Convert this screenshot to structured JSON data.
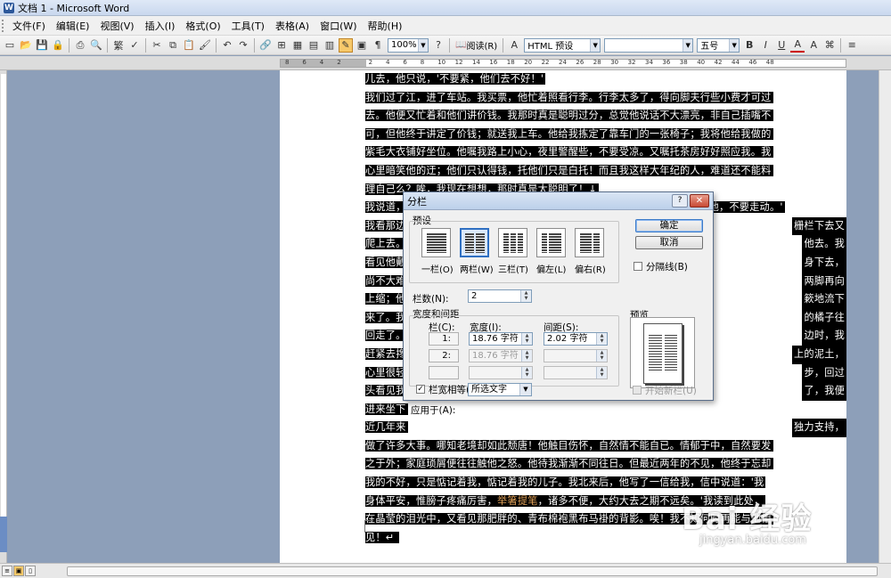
{
  "window": {
    "title": "文档 1 - Microsoft Word"
  },
  "menu": [
    "文件(F)",
    "编辑(E)",
    "视图(V)",
    "插入(I)",
    "格式(O)",
    "工具(T)",
    "表格(A)",
    "窗口(W)",
    "帮助(H)"
  ],
  "toolbar": {
    "zoom": "100%",
    "read_label": "阅读(R)",
    "style": "HTML 预设",
    "font_name": "",
    "font_size": "五号",
    "bold_label": "B",
    "italic_label": "I",
    "underline_label": "U",
    "font_color_label": "A"
  },
  "ruler": [
    "8",
    "6",
    "4",
    "2",
    "2",
    "4",
    "6",
    "8",
    "10",
    "12",
    "14",
    "16",
    "18",
    "20",
    "22",
    "24",
    "26",
    "28",
    "30",
    "32",
    "34",
    "36",
    "38",
    "40",
    "42",
    "44",
    "46",
    "48"
  ],
  "document": {
    "lines": [
      "儿去，他只说，'不要紧，他们去不好！'",
      "我们过了江，进了车站。我买票，他忙着照看行李。行李太多了，得向脚夫行些小费才可过",
      "去。他便又忙着和他们讲价钱。我那时真是聪明过分，总觉他说话不大漂亮，非自己插嘴不",
      "可，但他终于讲定了价钱；就送我上车。他给我拣定了靠车门的一张椅子；我将他给我做的",
      "紫毛大衣铺好坐位。他嘱我路上小心，夜里警醒些，不要受凉。又嘱托茶房好好照应我。我",
      "心里暗笑他的迂；他们只认得钱，托他们只是白托！而且我这样大年纪的人，难道还不能料",
      "理自己么？唉，我现在想想，那时真是太聪明了！↓",
      "我说道，'爸爸，你走吧。'他望车外看了看，说，'我买几个橘子去。你就在此地，不要走动。'",
      "我看那边",
      "爬上去。",
      "看见他戴",
      "尚不大难",
      "上缩；他",
      "来了。我",
      "回走了。",
      "赶紧去搀",
      "心里很轻",
      "头看见我",
      "进来坐下",
      "近几年来",
      "做了许多大事。哪知老境却如此颓唐！他触目伤怀，自然情不能自已。情郁于中，自然要发",
      "之于外；家庭琐屑便往往触他之怒。他待我渐渐不同往日。但最近两年的不见，他终于忘却",
      "我的不好，只是惦记着我，惦记着我的儿子。我北来后，他写了一信给我，信中说道：'我",
      "身体平安，惟膀子疼痛厉害，举箸提笔，诸多不便，大约大去之期不远矣。'我读到此处，",
      "在晶莹的泪光中，又看见那肥胖的、青布棉袍黑布马褂的背影。唉！我不知何时再能与他相",
      "见！↵"
    ],
    "right_fragments": [
      {
        "line": 8,
        "text": "栅栏下去又"
      },
      {
        "line": 9,
        "text": "他去。我"
      },
      {
        "line": 10,
        "text": "身下去，"
      },
      {
        "line": 11,
        "text": "两脚再向"
      },
      {
        "line": 12,
        "text": "簌地流下"
      },
      {
        "line": 13,
        "text": "的橘子往"
      },
      {
        "line": 14,
        "text": "边时，我"
      },
      {
        "line": 15,
        "text": "上的泥土，"
      },
      {
        "line": 16,
        "text": "步，回过"
      },
      {
        "line": 17,
        "text": "了，我便"
      },
      {
        "line": 19,
        "text": "独力支持，"
      }
    ],
    "highlight_phrase": "举箸提笔"
  },
  "dialog": {
    "title": "分栏",
    "help": "?",
    "close": "✕",
    "presets_label": "预设",
    "presets": [
      "一栏(O)",
      "两栏(W)",
      "三栏(T)",
      "偏左(L)",
      "偏右(R)"
    ],
    "num_cols_label": "栏数(N):",
    "num_cols": "2",
    "width_spacing_label": "宽度和间距",
    "col_header": "栏(C):",
    "width_header": "宽度(I):",
    "spacing_header": "间距(S):",
    "rows": [
      {
        "col": "1:",
        "width": "18.76 字符",
        "spacing": "2.02 字符"
      },
      {
        "col": "2:",
        "width": "18.76 字符",
        "spacing": ""
      },
      {
        "col": "",
        "width": "",
        "spacing": ""
      }
    ],
    "equal_width": "栏宽相等(E)",
    "apply_label": "应用于(A):",
    "apply_value": "所选文字",
    "ok": "确定",
    "cancel": "取消",
    "line_between": "分隔线(B)",
    "preview_label": "预览",
    "start_new_col": "开始新栏(U)"
  },
  "watermark": {
    "brand": "Bai 经验",
    "url": "jingyan.baidu.com"
  }
}
